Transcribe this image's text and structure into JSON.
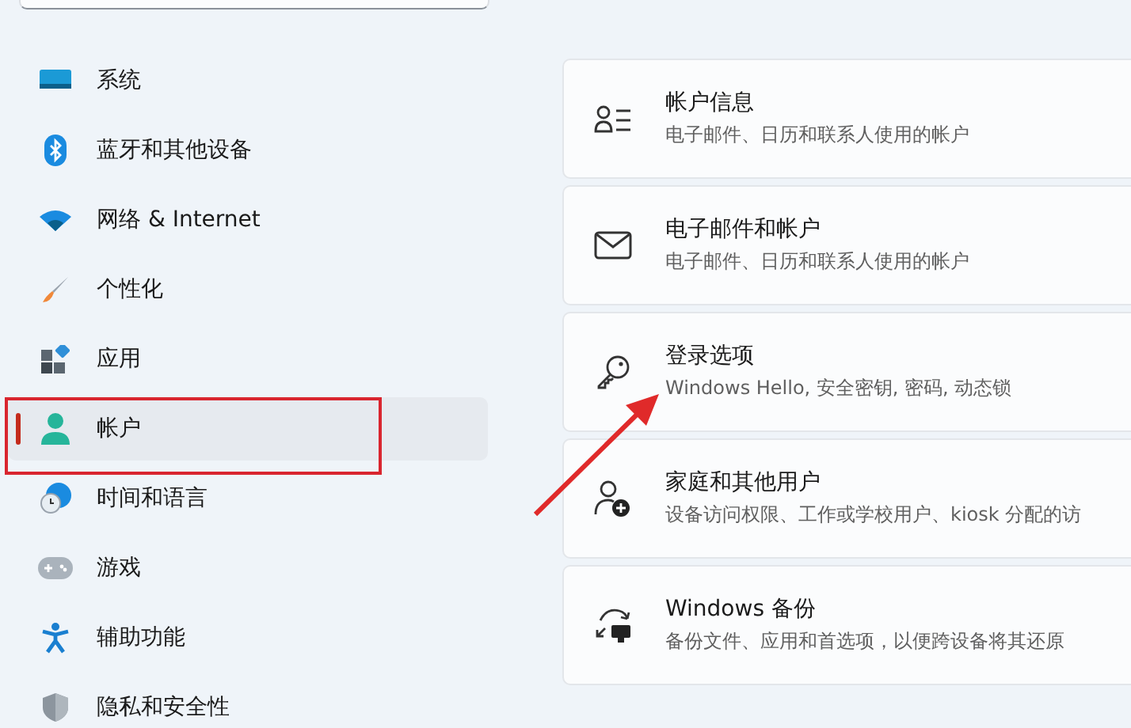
{
  "sidebar": {
    "items": [
      {
        "label": "系统",
        "selected": false
      },
      {
        "label": "蓝牙和其他设备",
        "selected": false
      },
      {
        "label": "网络 & Internet",
        "selected": false
      },
      {
        "label": "个性化",
        "selected": false
      },
      {
        "label": "应用",
        "selected": false
      },
      {
        "label": "帐户",
        "selected": true
      },
      {
        "label": "时间和语言",
        "selected": false
      },
      {
        "label": "游戏",
        "selected": false
      },
      {
        "label": "辅助功能",
        "selected": false
      },
      {
        "label": "隐私和安全性",
        "selected": false
      }
    ]
  },
  "cards": [
    {
      "title": "帐户信息",
      "subtitle": "电子邮件、日历和联系人使用的帐户"
    },
    {
      "title": "电子邮件和帐户",
      "subtitle": "电子邮件、日历和联系人使用的帐户"
    },
    {
      "title": "登录选项",
      "subtitle": "Windows Hello, 安全密钥, 密码, 动态锁"
    },
    {
      "title": "家庭和其他用户",
      "subtitle": "设备访问权限、工作或学校用户、kiosk 分配的访"
    },
    {
      "title": "Windows 备份",
      "subtitle": "备份文件、应用和首选项，以便跨设备将其还原"
    }
  ]
}
